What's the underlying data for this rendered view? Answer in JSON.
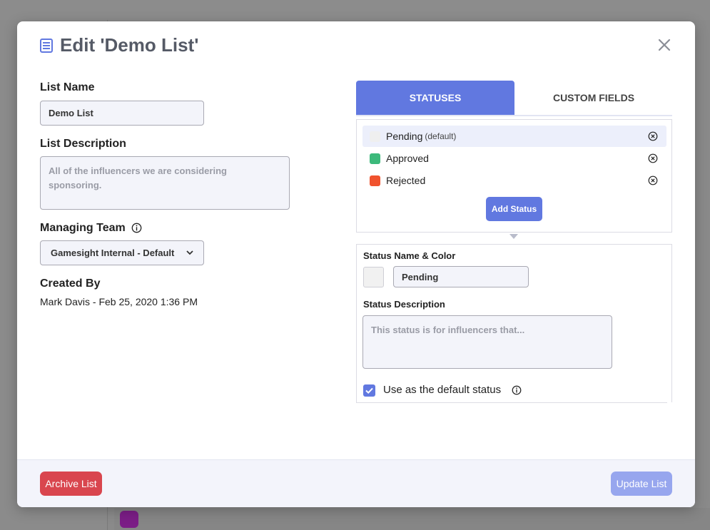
{
  "modal": {
    "title": "Edit 'Demo List'",
    "title_icon": "list-document-icon",
    "close_icon": "close-icon"
  },
  "form": {
    "list_name_label": "List Name",
    "list_name_value": "Demo List",
    "list_description_label": "List Description",
    "list_description_placeholder": "All of the influencers we are considering sponsoring.",
    "managing_team_label": "Managing Team",
    "managing_team_value": "Gamesight Internal - Default",
    "created_by_label": "Created By",
    "created_by_value": "Mark Davis - Feb 25, 2020 1:36 PM"
  },
  "tabs": [
    {
      "label": "STATUSES",
      "active": true
    },
    {
      "label": "CUSTOM FIELDS",
      "active": false
    }
  ],
  "statuses": [
    {
      "name": "Pending",
      "tag": "(default)",
      "color": "#efefef",
      "selected": true
    },
    {
      "name": "Approved",
      "tag": "",
      "color": "#3cb97b",
      "selected": false
    },
    {
      "name": "Rejected",
      "tag": "",
      "color": "#f0532e",
      "selected": false
    }
  ],
  "add_status_label": "Add Status",
  "status_detail": {
    "name_color_label": "Status Name & Color",
    "name_value": "Pending",
    "description_label": "Status Description",
    "description_placeholder": "This status is for influencers that...",
    "default_checkbox_label": "Use as the default status",
    "default_checked": true
  },
  "footer": {
    "archive_label": "Archive List",
    "update_label": "Update List"
  },
  "colors": {
    "accent": "#6178e0",
    "danger": "#d9464e",
    "update_disabled": "#97a6ee"
  }
}
